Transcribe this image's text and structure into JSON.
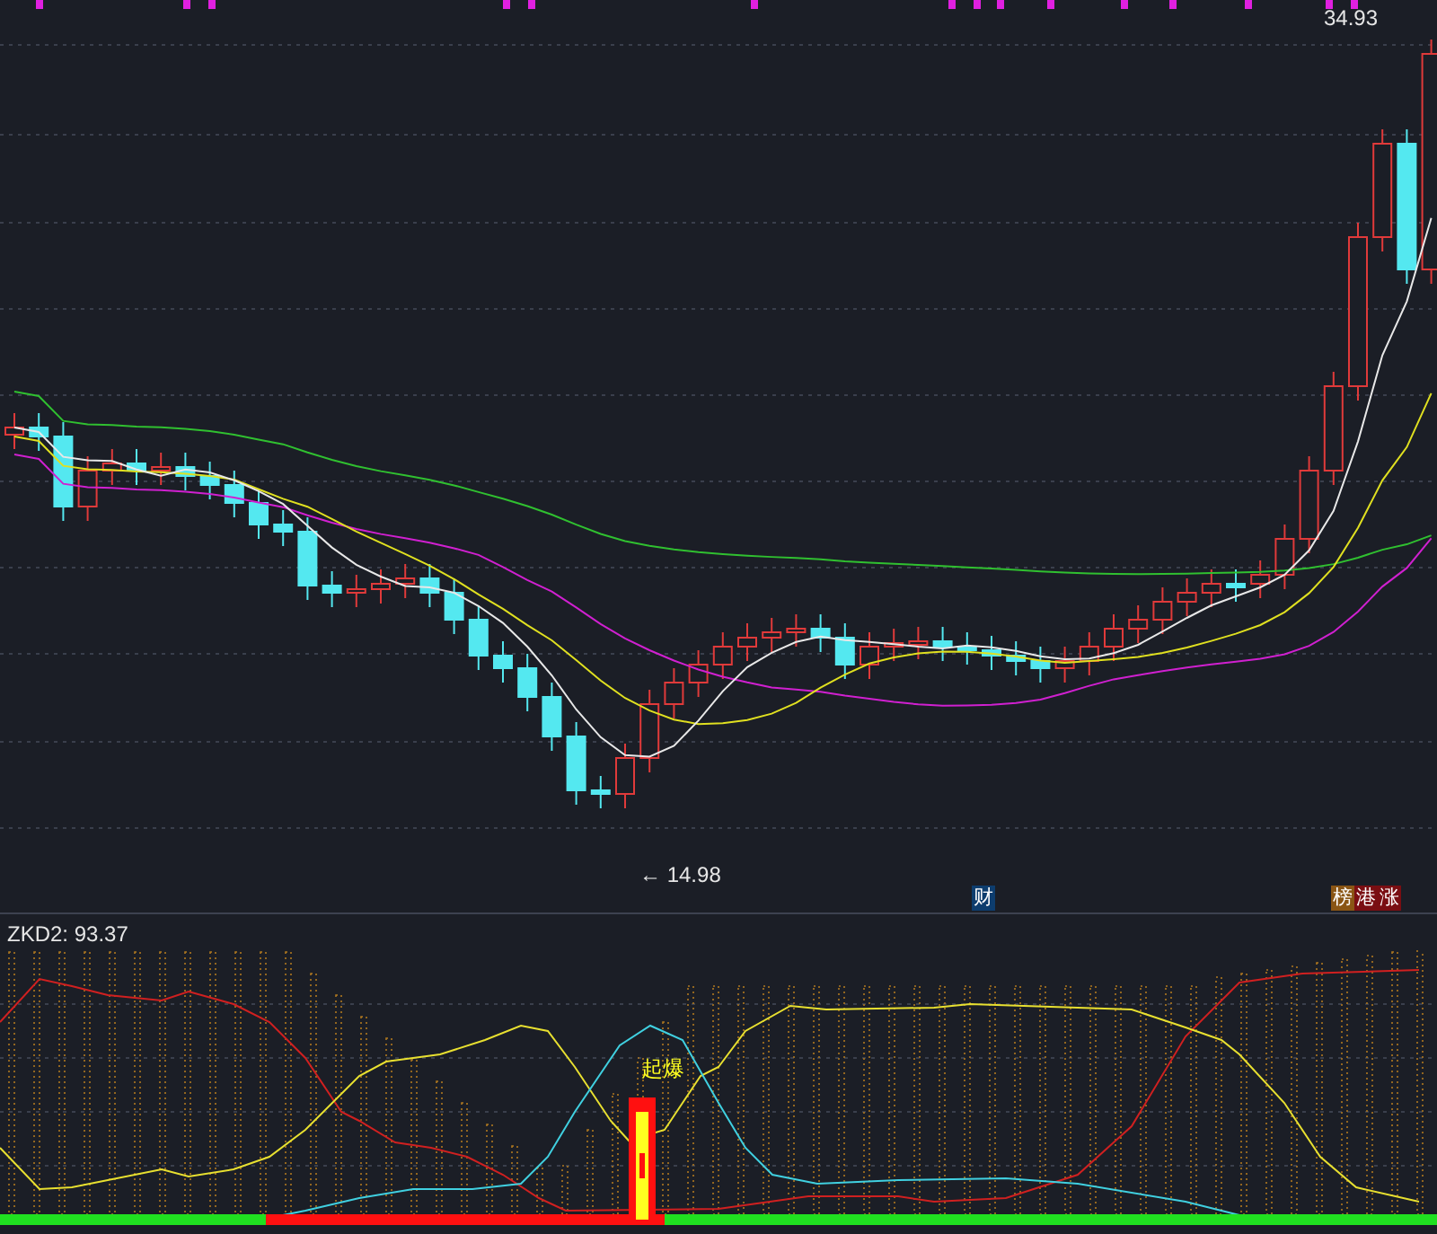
{
  "price_chart": {
    "high_label": "34.93",
    "low_label": "← 14.98"
  },
  "badges": [
    {
      "text": "财",
      "color": "#0d3d6e"
    },
    {
      "text": "榜",
      "color": "#8a5514"
    },
    {
      "text": "港",
      "color": "#7a0e12"
    },
    {
      "text": "涨",
      "color": "#7a0e12"
    }
  ],
  "indicator": {
    "label": "ZKD2: 93.37",
    "signal_label": "起爆"
  }
}
